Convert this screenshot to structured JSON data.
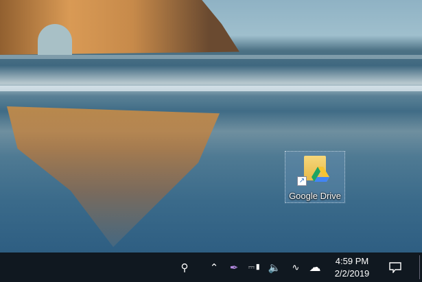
{
  "desktop": {
    "icons": [
      {
        "label": "Google Drive",
        "icon": "google-drive-shortcut-icon"
      }
    ]
  },
  "taskbar": {
    "tray": [
      "people-icon",
      "chevron-up-icon",
      "feather-icon",
      "battery-icon",
      "volume-icon",
      "wifi-icon",
      "cloud-sync-icon"
    ],
    "clock": {
      "time": "4:59 PM",
      "date": "2/2/2019"
    },
    "action_center": "notification-icon"
  }
}
